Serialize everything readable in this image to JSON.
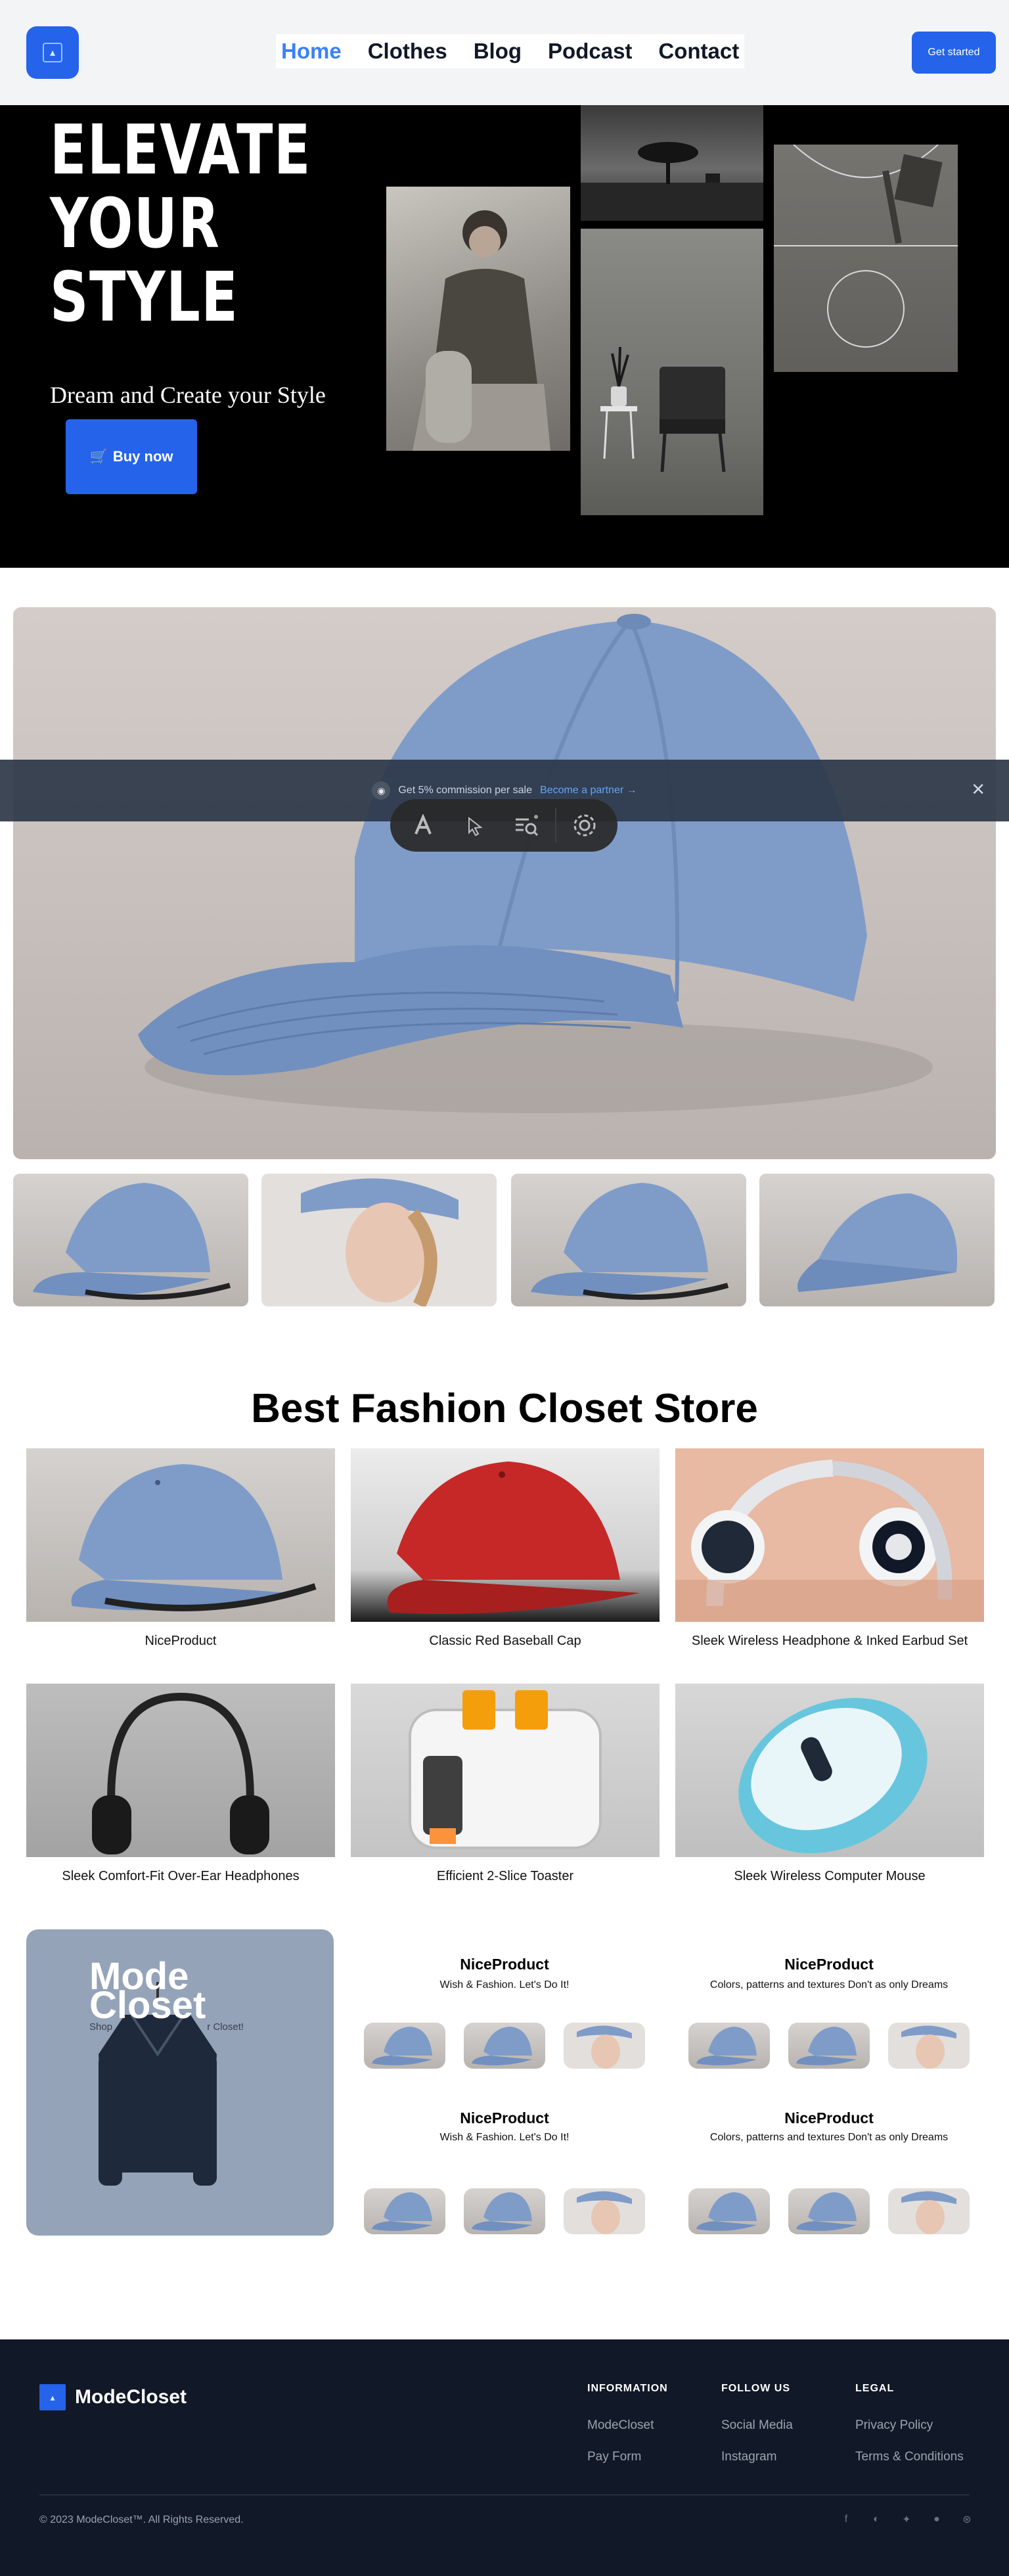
{
  "nav": {
    "logo_icon": "brand-logo-icon",
    "links": [
      "Home",
      "Clothes",
      "Blog",
      "Podcast",
      "Contact"
    ],
    "active_link": "Home",
    "cta": "Get started"
  },
  "hero": {
    "title_lines": [
      "ELEVATE",
      "YOUR",
      "STYLE"
    ],
    "subtitle": "Dream and Create your Style",
    "button": "Buy now",
    "button_icon": "cart-icon"
  },
  "promo_bar": {
    "text": "Get 5% commission per sale",
    "link": "Become a partner",
    "link_icon": "arrow-right-icon",
    "close_icon": "close-icon"
  },
  "toolbar": {
    "tools": [
      "logo-tool-icon",
      "cursor-tool-icon",
      "search-list-icon",
      "gear-icon"
    ]
  },
  "store": {
    "title": "Best Fashion Closet Store",
    "products": [
      "NiceProduct",
      "Classic Red Baseball Cap",
      "Sleek Wireless Headphone & Inked Earbud Set",
      "Sleek Comfort-Fit Over-Ear Headphones",
      "Efficient 2-Slice Toaster",
      "Sleek Wireless Computer Mouse"
    ]
  },
  "promo_card": {
    "title_line1": "Mode",
    "title_line2": "Closet",
    "text": "Shop",
    "text_tail": "r Closet!"
  },
  "mini_products": [
    {
      "title": "NiceProduct",
      "desc": "Wish & Fashion. Let's Do It!"
    },
    {
      "title": "NiceProduct",
      "desc": "Colors, patterns and textures Don't as only Dreams"
    },
    {
      "title": "NiceProduct",
      "desc": "Wish & Fashion. Let's Do It!"
    },
    {
      "title": "NiceProduct",
      "desc": "Colors, patterns and textures Don't as only Dreams"
    }
  ],
  "footer": {
    "brand": "ModeCloset",
    "columns": [
      {
        "heading": "INFORMATION",
        "links": [
          "ModeCloset",
          "Pay Form"
        ]
      },
      {
        "heading": "FOLLOW US",
        "links": [
          "Social Media",
          "Instagram"
        ]
      },
      {
        "heading": "LEGAL",
        "links": [
          "Privacy Policy",
          "Terms & Conditions"
        ]
      }
    ],
    "copyright": "© 2023 ModeCloset™. All Rights Reserved.",
    "socials": [
      "facebook-icon",
      "discord-icon",
      "twitter-icon",
      "github-icon",
      "dribbble-icon"
    ]
  },
  "colors": {
    "accent": "#2563eb",
    "active_link": "#3b82f6",
    "footer_bg": "#111827",
    "cap_blue": "#7f9cc9",
    "cap_red": "#c62828"
  }
}
